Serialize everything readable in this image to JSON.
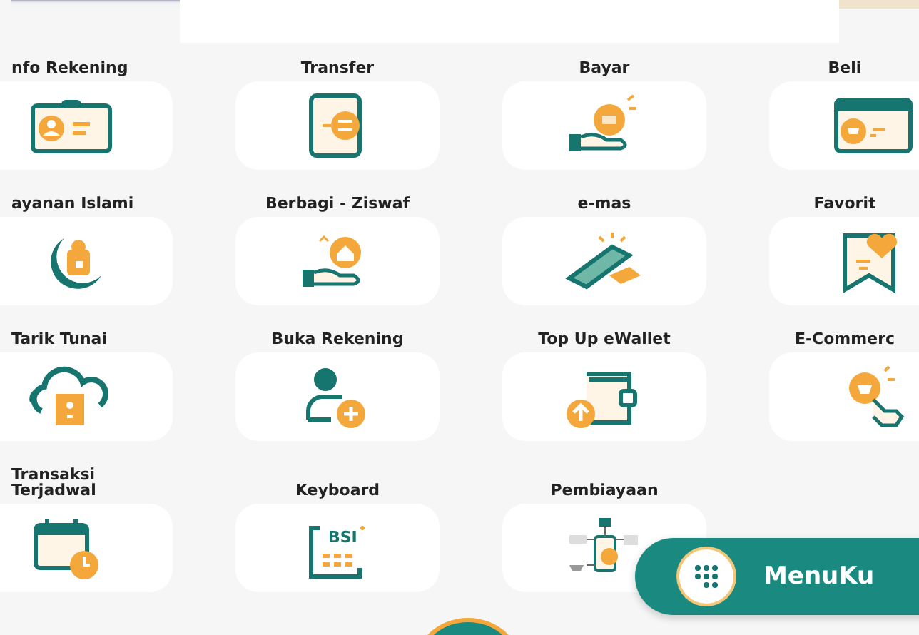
{
  "menu": [
    {
      "label": "nfo Rekening"
    },
    {
      "label": "Transfer"
    },
    {
      "label": "Bayar"
    },
    {
      "label": "Beli"
    },
    {
      "label": "ayanan Islami"
    },
    {
      "label": "Berbagi - Ziswaf"
    },
    {
      "label": "e-mas"
    },
    {
      "label": "Favorit"
    },
    {
      "label": "Tarik Tunai"
    },
    {
      "label": "Buka Rekening"
    },
    {
      "label": "Top Up eWallet"
    },
    {
      "label": "E-Commerc"
    },
    {
      "label": "Transaksi Terjadwal"
    },
    {
      "label": "Keyboard",
      "badge": "BSI"
    },
    {
      "label": "Pembiayaan"
    }
  ],
  "menuku_button": {
    "label": "MenuKu"
  }
}
